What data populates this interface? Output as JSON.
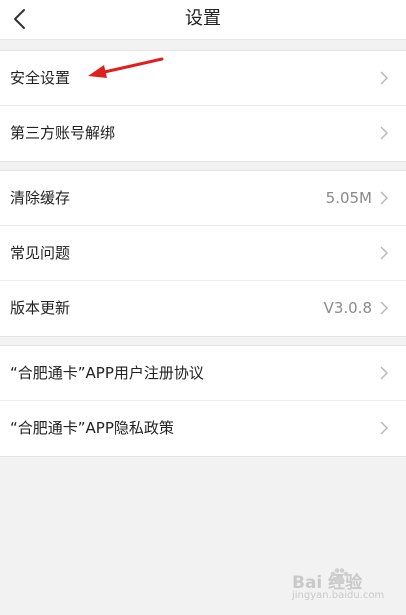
{
  "header": {
    "title": "设置"
  },
  "groups": [
    {
      "items": [
        {
          "label": "安全设置",
          "value": ""
        },
        {
          "label": "第三方账号解绑",
          "value": ""
        }
      ]
    },
    {
      "items": [
        {
          "label": "清除缓存",
          "value": "5.05M"
        },
        {
          "label": "常见问题",
          "value": ""
        },
        {
          "label": "版本更新",
          "value": "V3.0.8"
        }
      ]
    },
    {
      "items": [
        {
          "label": "“合肥通卡”APP用户注册协议",
          "value": ""
        },
        {
          "label": "“合肥通卡”APP隐私政策",
          "value": ""
        }
      ]
    }
  ],
  "annotation": {
    "arrow_color": "#e0201f",
    "target": "安全设置"
  },
  "watermark": {
    "brand": "Bai  经验",
    "url": "jingyan.baidu.com"
  },
  "colors": {
    "background": "#f2f2f2",
    "row_background": "#ffffff",
    "chevron": "#b8b8b8",
    "value_text": "#8a8a8a"
  },
  "icons": {
    "back": "chevron-left-icon",
    "row_chevron": "chevron-right-icon",
    "watermark_paw": "paw-icon"
  }
}
